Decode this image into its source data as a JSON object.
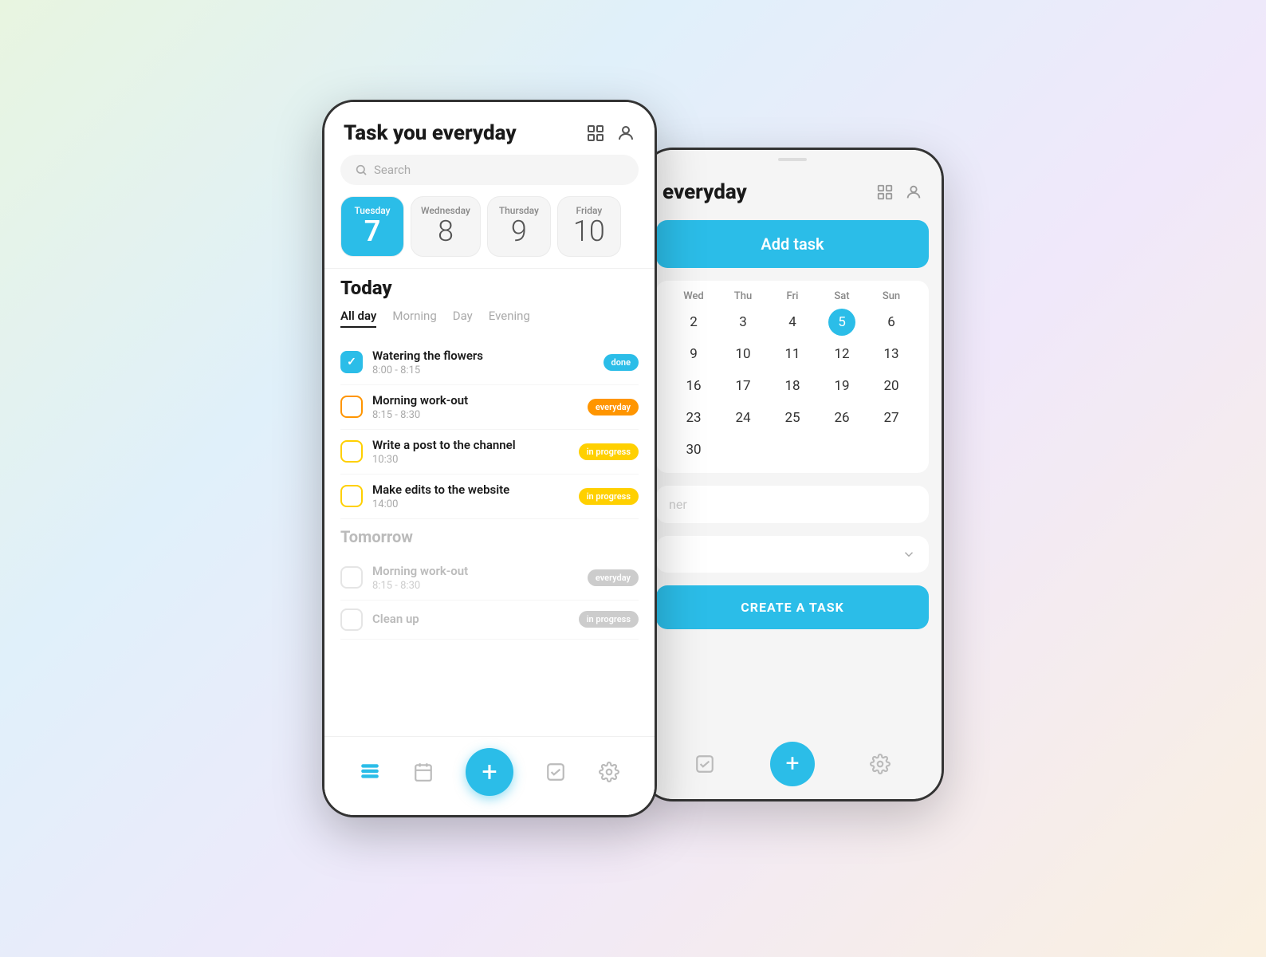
{
  "app": {
    "title": "Task you everyday",
    "title_short": "everyday",
    "search_placeholder": "Search"
  },
  "dates": [
    {
      "day_name": "Tuesday",
      "day_num": "7",
      "active": true
    },
    {
      "day_name": "Wednesday",
      "day_num": "8",
      "active": false
    },
    {
      "day_name": "Thursday",
      "day_num": "9",
      "active": false
    },
    {
      "day_name": "Friday",
      "day_num": "10",
      "active": false
    }
  ],
  "time_tabs": [
    {
      "label": "All day",
      "active": true
    },
    {
      "label": "Morning",
      "active": false
    },
    {
      "label": "Day",
      "active": false
    },
    {
      "label": "Evening",
      "active": false
    }
  ],
  "today_section": "Today",
  "tomorrow_section": "Tomorrow",
  "today_tasks": [
    {
      "name": "Watering the flowers",
      "time": "8:00 - 8:15",
      "badge": "done",
      "badge_text": "done",
      "checked": true
    },
    {
      "name": "Morning work-out",
      "time": "8:15 - 8:30",
      "badge": "everyday",
      "badge_text": "everyday",
      "checked": false
    },
    {
      "name": "Write a post to the channel",
      "time": "10:30",
      "badge": "inprogress",
      "badge_text": "in progress",
      "checked": false
    },
    {
      "name": "Make edits to the website",
      "time": "14:00",
      "badge": "inprogress",
      "badge_text": "in progress",
      "checked": false
    }
  ],
  "tomorrow_tasks": [
    {
      "name": "Morning work-out",
      "time": "8:15 - 8:30",
      "badge": "everyday",
      "badge_text": "everyday"
    },
    {
      "name": "Clean up",
      "time": "",
      "badge": "inprogress",
      "badge_text": "in progress"
    }
  ],
  "back_phone": {
    "title": "everyday",
    "add_task": "Add task",
    "calendar_header": [
      "Wed",
      "Thu",
      "Fri",
      "Sat",
      "Sun"
    ],
    "calendar_rows": [
      [
        "2",
        "3",
        "4",
        "5",
        "6"
      ],
      [
        "9",
        "10",
        "11",
        "12",
        "13"
      ],
      [
        "16",
        "17",
        "18",
        "19",
        "20"
      ],
      [
        "23",
        "24",
        "25",
        "26",
        "27"
      ],
      [
        "30",
        "",
        "",
        "",
        ""
      ]
    ],
    "selected_date": "5",
    "input_placeholder": "ner",
    "create_btn": "CREATE A TASK"
  },
  "nav": {
    "plus": "+",
    "icons": [
      "list",
      "calendar",
      "plus",
      "check",
      "settings"
    ]
  }
}
